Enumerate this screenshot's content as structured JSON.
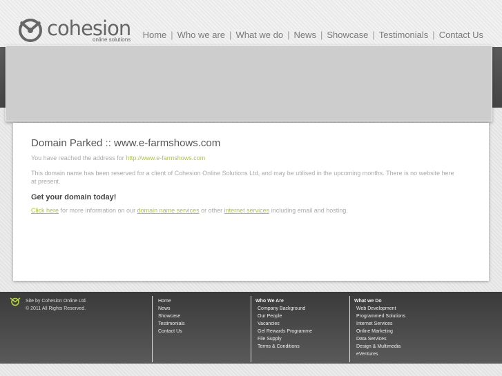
{
  "brand": {
    "name": "cohesion",
    "tagline": "online solutions"
  },
  "nav": {
    "items": [
      "Home",
      "Who we are",
      "What we do",
      "News",
      "Showcase",
      "Testimonials",
      "Contact Us"
    ],
    "separator": "|"
  },
  "content": {
    "title": "Domain Parked :: www.e-farmshows.com",
    "reached_prefix": "You have reached the address for ",
    "reached_link": "http://www.e-farmshows.com",
    "reserved_text": "This domain name has been reserved for a client of Cohesion Online Solutions Ltd, and may be utilised in the upcoming months. There is no website here at present.",
    "get_domain": "Get your domain today!",
    "click_here": "Click here",
    "more_info_1": " for more information on our ",
    "domain_services": "domain name services",
    "more_info_2": " or other ",
    "internet_services": "internet services",
    "more_info_3": " including email and hosting."
  },
  "footer": {
    "credit_line1": "Site by Cohesion Online Ltd.",
    "credit_line2": "© 2011 All Rights Reserved.",
    "col1": [
      "Home",
      "News",
      "Showcase",
      "Testimonials",
      "Contact Us"
    ],
    "col2_heading": "Who We Are",
    "col2": [
      "Company Background",
      "Our People",
      "Vacancies",
      "Gel Rewards Programme",
      "File Supply",
      "Terms & Conditions"
    ],
    "col3_heading": "What we Do",
    "col3": [
      "Web Development",
      "Programmed Solutions",
      "Internet Services",
      "Online Marketing",
      "Data Services",
      "Design & Multimedia",
      "eVentures"
    ]
  },
  "colors": {
    "link": "#a8c93a",
    "banner": "#cdcdcd"
  }
}
